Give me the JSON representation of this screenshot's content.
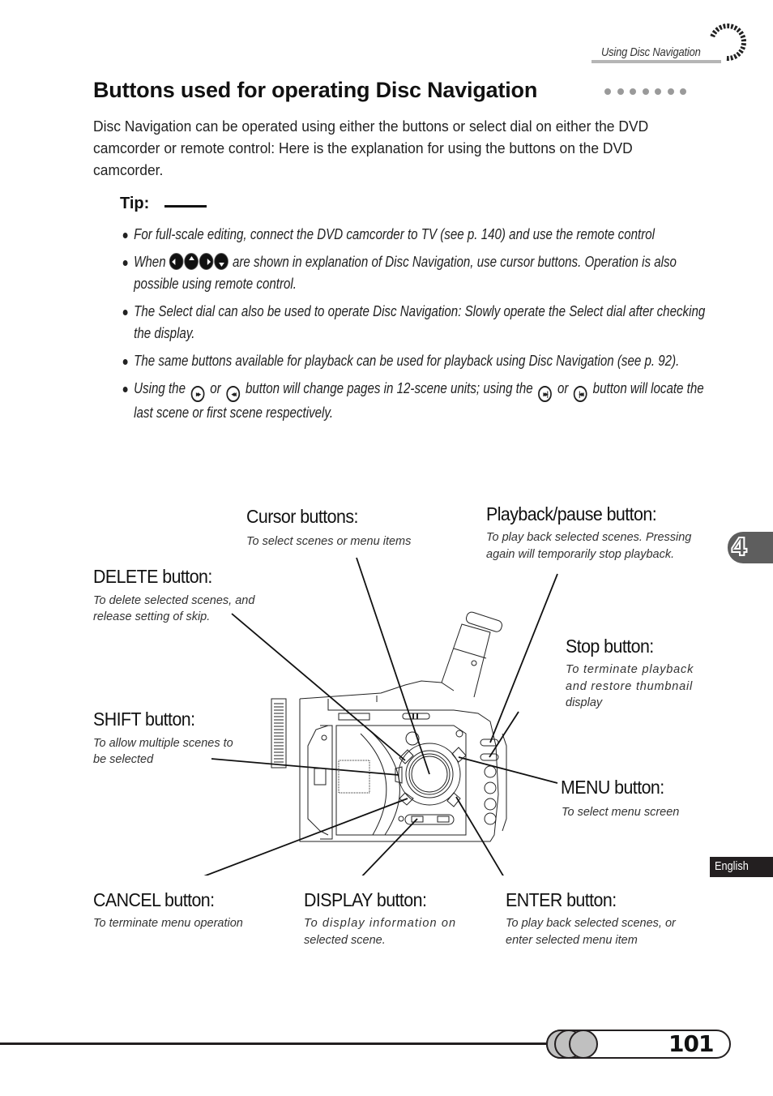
{
  "header": {
    "running_title": "Using Disc Navigation"
  },
  "section": {
    "title": "Buttons used for operating Disc Navigation",
    "intro": "Disc Navigation can be operated using either the buttons or select dial on either the DVD camcorder or remote control: Here is the explanation for using the buttons on the DVD camcorder."
  },
  "tip": {
    "label": "Tip:",
    "items": [
      {
        "text": "For full-scale editing, connect the DVD camcorder to TV (see p. 140) and use the remote control"
      },
      {
        "before": "When",
        "icons": [
          "cursor-left-icon",
          "cursor-up-icon",
          "cursor-right-icon",
          "cursor-down-icon"
        ],
        "after": "are shown in explanation of Disc Navigation, use cursor buttons. Operation is also possible using remote control."
      },
      {
        "text": "The Select dial can also be used to operate Disc Navigation: Slowly operate the Select dial after checking the display."
      },
      {
        "text": "The same buttons available for playback can be used for playback using Disc Navigation (see p. 92)."
      },
      {
        "part1": "Using the",
        "icon1": "▸▸",
        "part2": "or",
        "icon2": "◂◂",
        "part3": "button will change pages in 12-scene units; using the",
        "icon3": "▸▸|",
        "part4": "or",
        "icon4": "|◂◂",
        "part5": "button will locate the last scene or first scene respectively."
      }
    ]
  },
  "callouts": {
    "cursor": {
      "title": "Cursor buttons:",
      "desc": "To select scenes or menu items"
    },
    "playback": {
      "title": "Playback/pause button:",
      "desc_line1": "To play back selected scenes. Pressing",
      "desc_line2": "again will temporarily stop playback."
    },
    "delete": {
      "title": "DELETE button:",
      "desc_line1": "To delete selected scenes, and",
      "desc_line2": "release setting of skip."
    },
    "stop": {
      "title": "Stop button:",
      "desc_line1": "To terminate playback",
      "desc_line2": "and restore thumbnail",
      "desc_line3": "display"
    },
    "shift": {
      "title": "SHIFT button:",
      "desc_line1": "To allow multiple scenes to",
      "desc_line2": "be selected"
    },
    "menu": {
      "title": "MENU button:",
      "desc": "To select menu screen"
    },
    "cancel": {
      "title": "CANCEL button:",
      "desc": "To terminate menu operation"
    },
    "display": {
      "title": "DISPLAY button:",
      "desc_line1": "To display information on",
      "desc_line2": "selected scene."
    },
    "enter": {
      "title": "ENTER button:",
      "desc_line1": "To play back selected scenes, or",
      "desc_line2": "enter selected menu item"
    }
  },
  "side_tabs": {
    "chapter": "4",
    "language": "English"
  },
  "footer": {
    "page_number": "101"
  },
  "colors": {
    "text": "#1a1a1a",
    "tab_gray": "#5e5e5e",
    "dots_gray": "#9a9a9a",
    "lang_tab": "#231f20",
    "page_circle": "#c0c0c0"
  }
}
